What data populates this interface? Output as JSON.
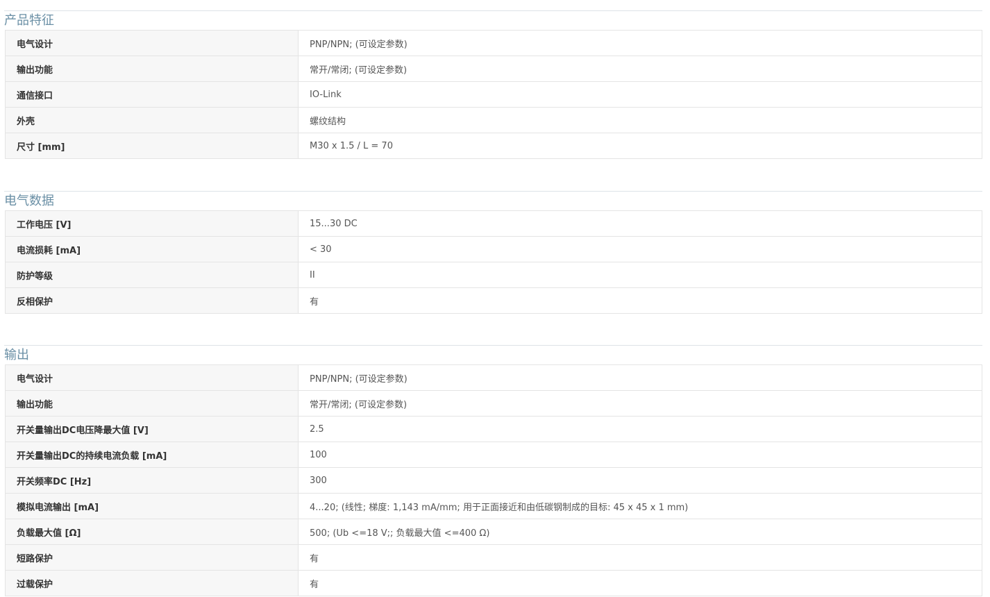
{
  "sections": [
    {
      "title": "产品特征",
      "rows": [
        {
          "label": "电气设计",
          "value": "PNP/NPN; (可设定参数)"
        },
        {
          "label": "输出功能",
          "value": "常开/常闭; (可设定参数)"
        },
        {
          "label": "通信接口",
          "value": "IO-Link"
        },
        {
          "label": "外壳",
          "value": "螺纹结构"
        },
        {
          "label": "尺寸 [mm]",
          "value": "M30 x 1.5 / L = 70"
        }
      ]
    },
    {
      "title": "电气数据",
      "rows": [
        {
          "label": "工作电压 [V]",
          "value": "15...30 DC"
        },
        {
          "label": "电流损耗 [mA]",
          "value": "< 30"
        },
        {
          "label": "防护等级",
          "value": "II"
        },
        {
          "label": "反相保护",
          "value": "有"
        }
      ]
    },
    {
      "title": "输出",
      "rows": [
        {
          "label": "电气设计",
          "value": "PNP/NPN; (可设定参数)"
        },
        {
          "label": "输出功能",
          "value": "常开/常闭; (可设定参数)"
        },
        {
          "label": "开关量输出DC电压降最大值 [V]",
          "value": "2.5"
        },
        {
          "label": "开关量输出DC的持续电流负载 [mA]",
          "value": "100"
        },
        {
          "label": "开关频率DC [Hz]",
          "value": "300"
        },
        {
          "label": "模拟电流输出 [mA]",
          "value": "4...20; (线性; 梯度: 1,143 mA/mm; 用于正面接近和由低碳钢制成的目标: 45 x 45 x 1 mm)"
        },
        {
          "label": "负载最大值 [Ω]",
          "value": "500; (Ub <=18 V;; 负载最大值 <=400 Ω)"
        },
        {
          "label": "短路保护",
          "value": "有"
        },
        {
          "label": "过载保护",
          "value": "有"
        }
      ]
    }
  ],
  "colors": {
    "section_title": "#6a8fa5",
    "label_background": "#f7f7f7",
    "border": "#e4e4e4"
  }
}
